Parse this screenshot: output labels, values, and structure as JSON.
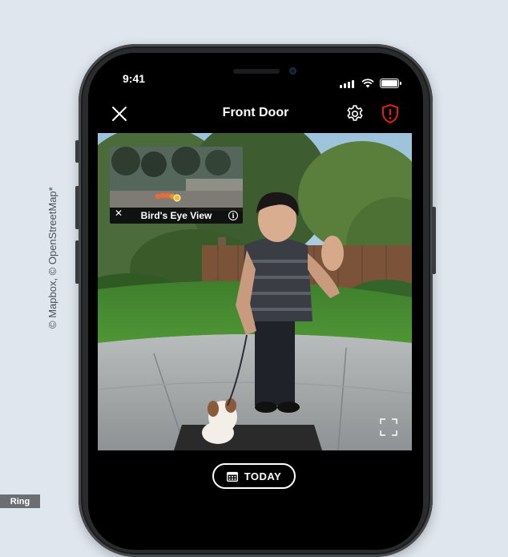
{
  "credits": {
    "vertical": "© Mapbox, © OpenStreetMap*",
    "corner": "Ring"
  },
  "status_bar": {
    "time": "9:41",
    "icons": [
      "cellular-signal-icon",
      "wifi-icon",
      "battery-icon"
    ]
  },
  "nav": {
    "title": "Front Door",
    "icons": {
      "close": "close-icon",
      "settings": "gear-icon",
      "alert": "shield-alert-icon"
    },
    "alert_color": "#e0211b"
  },
  "birds_eye": {
    "label": "Bird's Eye View",
    "close_icon": "close-icon",
    "info_icon": "info-icon",
    "info_glyph": "i"
  },
  "video": {
    "fullscreen_icon": "fullscreen-icon"
  },
  "footer": {
    "today_label": "TODAY",
    "today_icon": "calendar-icon"
  }
}
